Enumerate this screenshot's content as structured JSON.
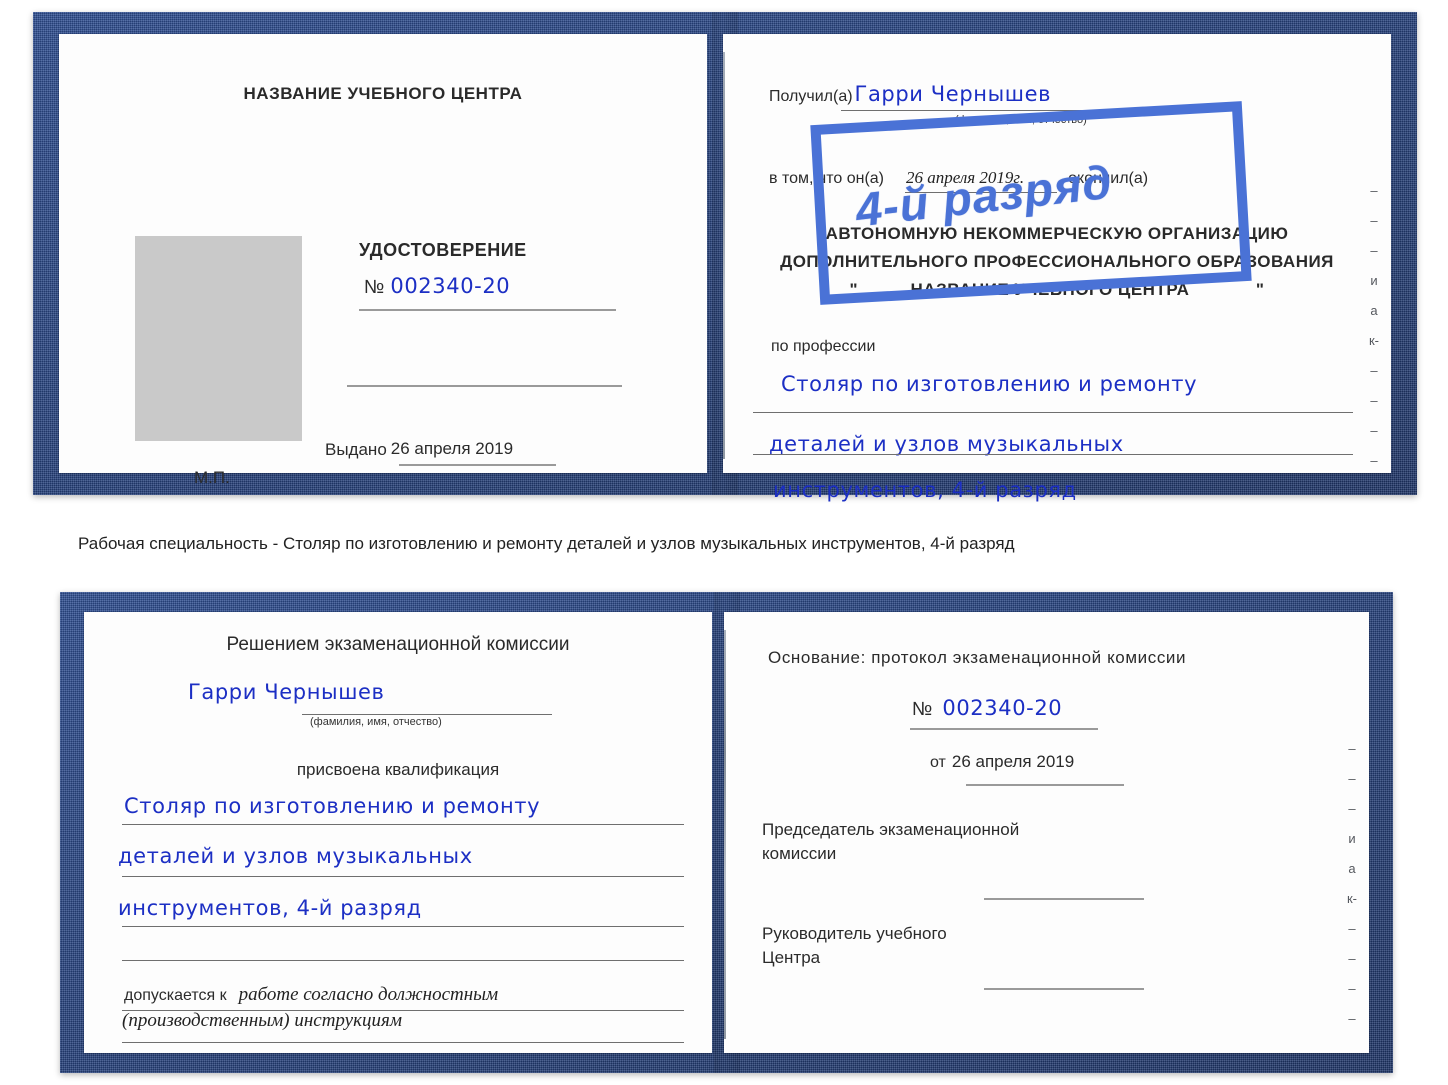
{
  "caption": {
    "text": "Рабочая специальность - Столяр по изготовлению и ремонту деталей и узлов музыкальных инструментов, 4-й разряд"
  },
  "stamp": {
    "text": "4-й разряд",
    "color": "#4a72d6"
  },
  "colors": {
    "cover_blue": "#2f4f93",
    "ink_blue": "#1c2fc4",
    "photo_gray": "#c9c9c9",
    "rule_gray": "#9a9a9a"
  },
  "certificate_top": {
    "left_page": {
      "header": "НАЗВАНИЕ УЧЕБНОГО ЦЕНТРА",
      "doc_title": "УДОСТОВЕРЕНИЕ",
      "number_symbol": "№",
      "number_value": "002340-20",
      "issued_label": "Выдано",
      "issued_value": "26 апреля 2019",
      "seal_label": "М.П.",
      "photo_placeholder": "photo-placeholder"
    },
    "right_page": {
      "received_label": "Получил(а)",
      "received_value": "Гарри Чернышев",
      "fio_hint": "(фамилия, имя, отчество)",
      "that_he_label": "в том, что он(а)",
      "that_he_date": "26 апреля 2019г.",
      "graduated_label": "окончил(а)",
      "org_line1": "АВТОНОМНУЮ НЕКОММЕРЧЕСКУЮ ОРГАНИЗАЦИЮ",
      "org_line2": "ДОПОЛНИТЕЛЬНОГО ПРОФЕССИОНАЛЬНОГО ОБРАЗОВАНИЯ",
      "org_quote_open": "\"",
      "org_line3": "НАЗВАНИЕ УЧЕБНОГО ЦЕНТРА",
      "org_quote_close": "\"",
      "profession_label": "по профессии",
      "profession_line1": "Столяр по изготовлению и ремонту",
      "profession_line2": "деталей и узлов музыкальных",
      "profession_line3": "инструментов, 4-й разряд",
      "edge_chars": [
        "–",
        "–",
        "–",
        "и",
        "а",
        "к-",
        "–",
        "–",
        "–",
        "–"
      ]
    }
  },
  "certificate_bottom": {
    "left_page": {
      "header": "Решением экзаменационной комиссии",
      "name_value": "Гарри Чернышев",
      "fio_hint": "(фамилия, имя, отчество)",
      "qualification_label": "присвоена квалификация",
      "qual_line1": "Столяр по изготовлению и ремонту",
      "qual_line2": "деталей и узлов музыкальных",
      "qual_line3": "инструментов, 4-й разряд",
      "admitted_label": "допускается к",
      "admitted_value1": "работе согласно должностным",
      "admitted_value2": "(производственным) инструкциям"
    },
    "right_page": {
      "basis_label": "Основание: протокол экзаменационной комиссии",
      "number_symbol": "№",
      "number_value": "002340-20",
      "from_label": "от",
      "from_value": "26 апреля 2019",
      "chairman_line1": "Председатель экзаменационной",
      "chairman_line2": "комиссии",
      "director_line1": "Руководитель учебного",
      "director_line2": "Центра",
      "edge_chars": [
        "–",
        "–",
        "–",
        "и",
        "а",
        "к-",
        "–",
        "–",
        "–",
        "–"
      ]
    }
  }
}
